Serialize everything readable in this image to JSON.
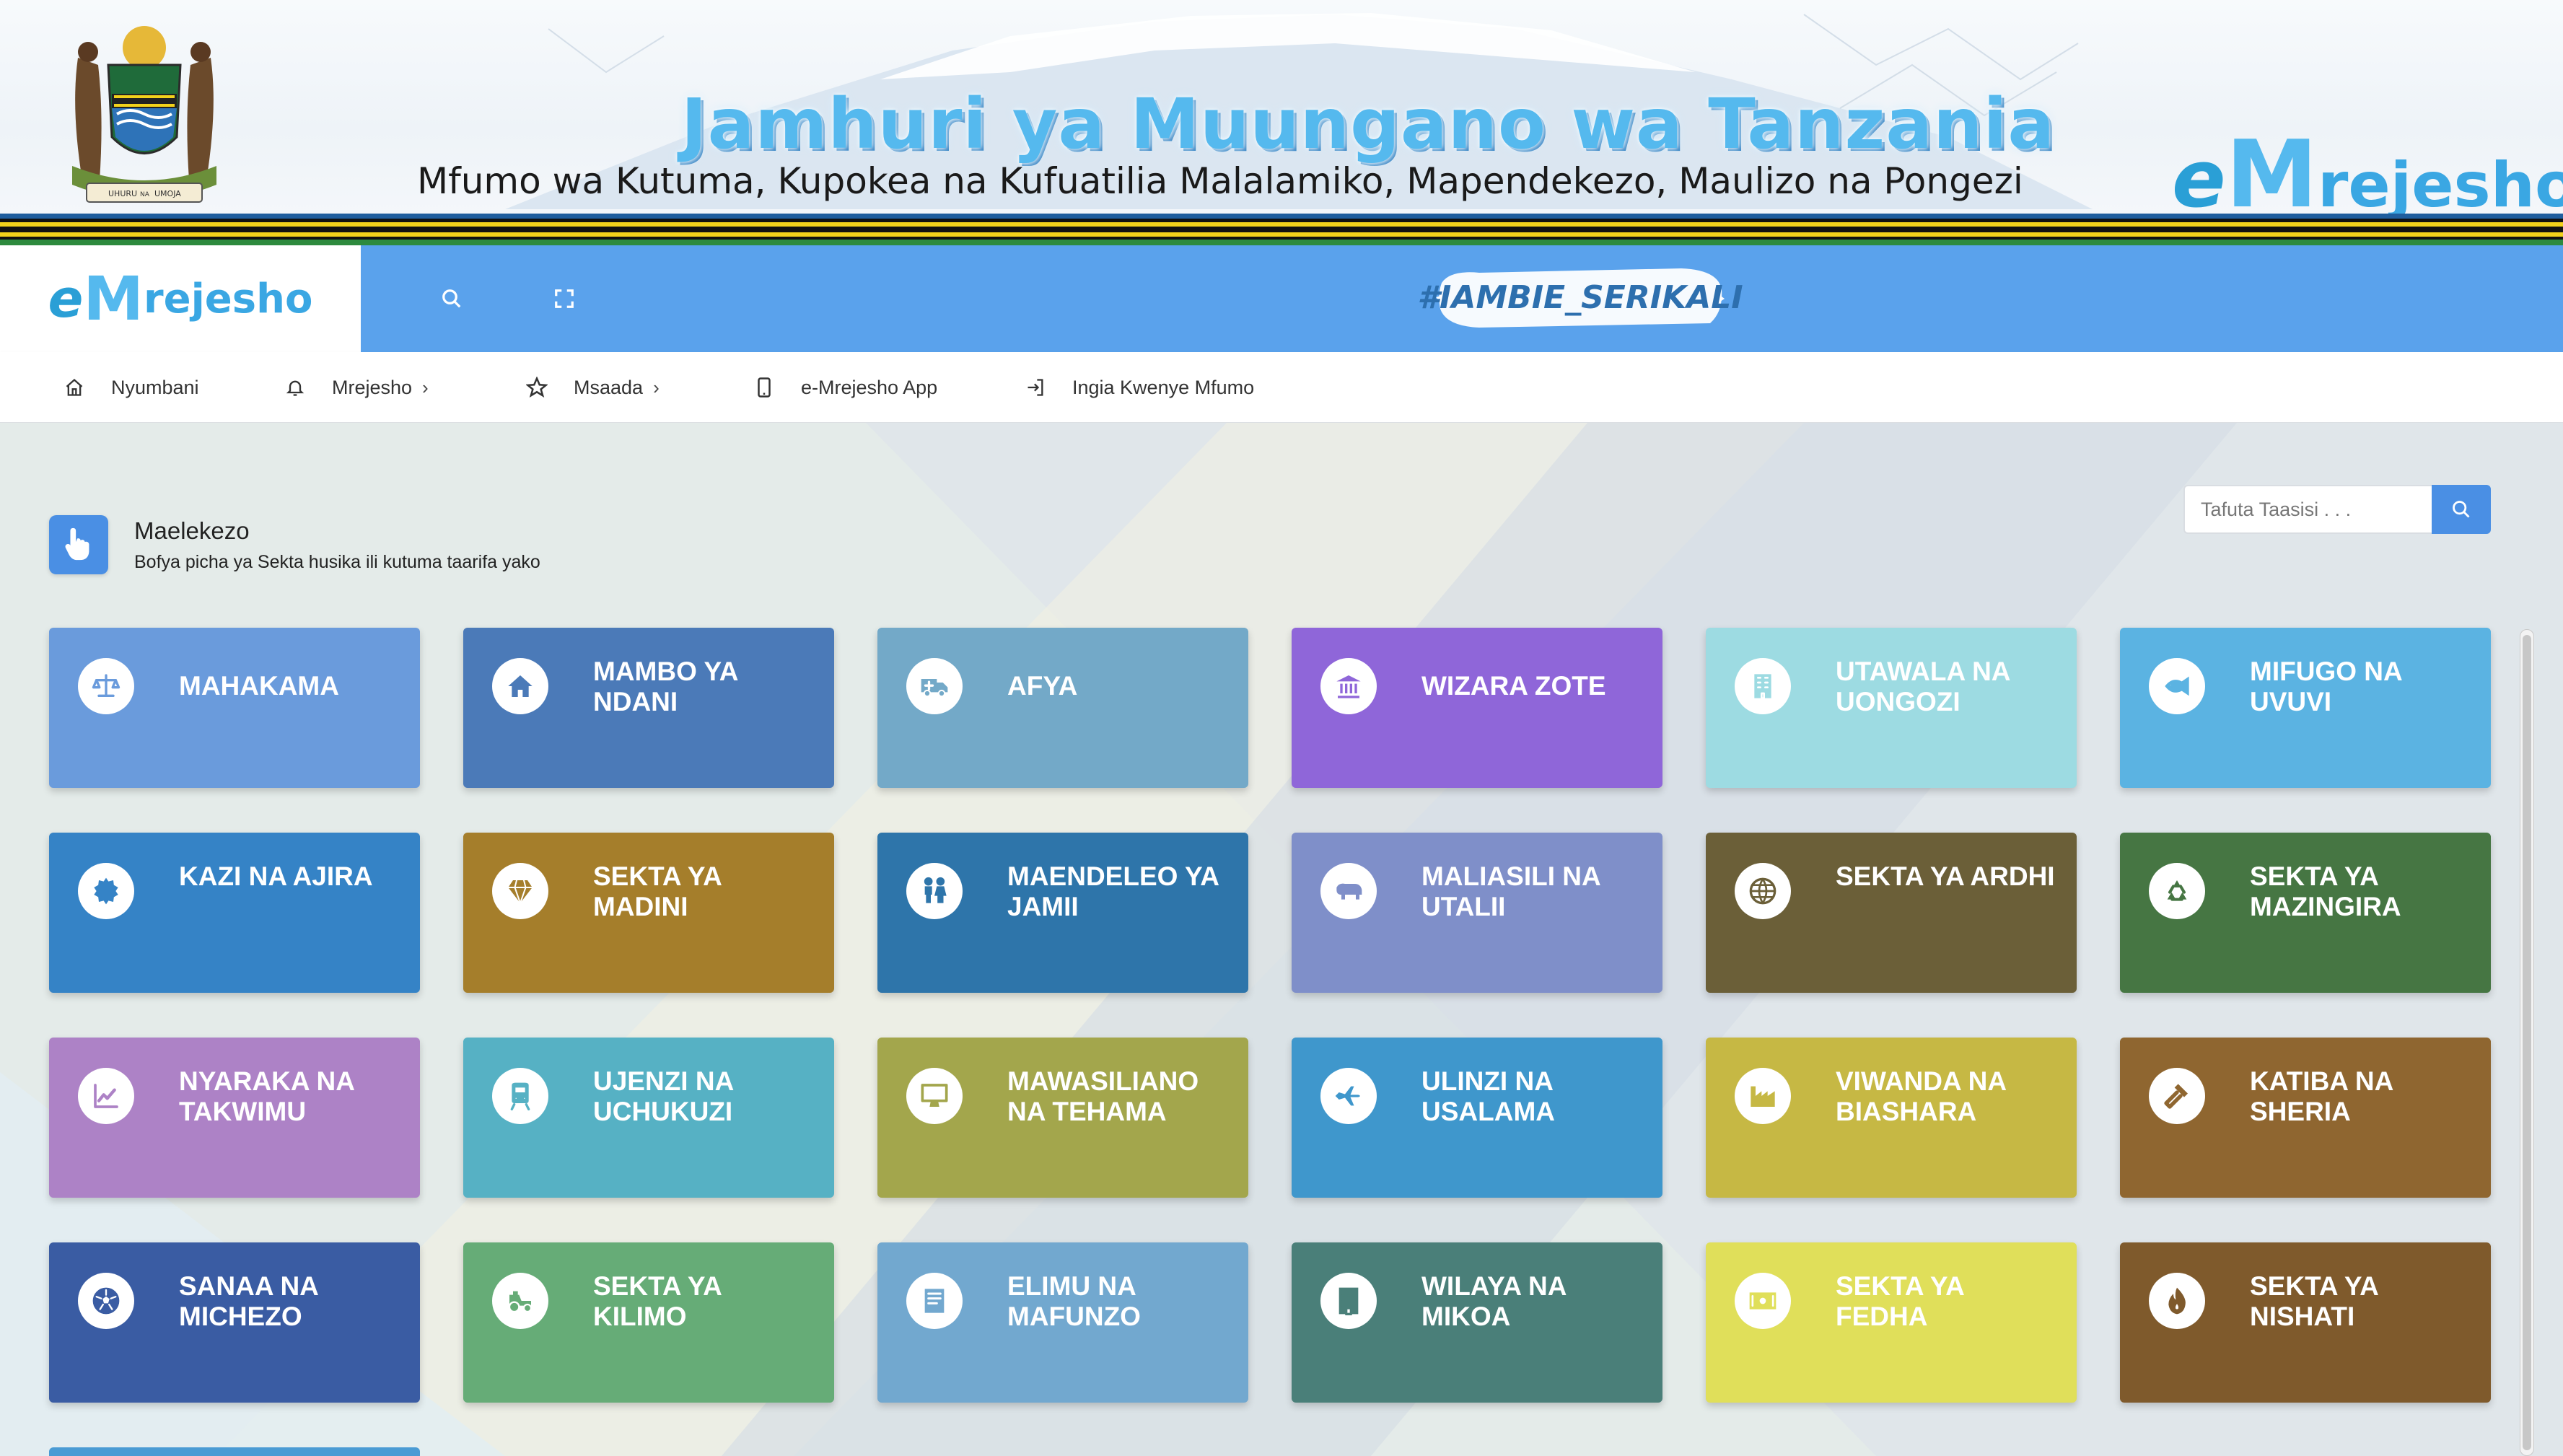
{
  "banner": {
    "title": "Jamhuri ya Muungano wa Tanzania",
    "subtitle": "Mfumo wa Kutuma, Kupokea na Kufuatilia Malalamiko, Mapendekezo, Maulizo na Pongezi",
    "logo": {
      "e": "e",
      "m": "M",
      "rest": "rejesho"
    },
    "coat_motto": {
      "left": "UHURU",
      "right": "UMOJA",
      "center": "NA"
    }
  },
  "topbar": {
    "logo": {
      "e": "e",
      "m": "M",
      "rest": "rejesho"
    },
    "icons": [
      "search-icon",
      "fullscreen-icon"
    ],
    "hashtag": "#IAMBIE_SERIKALI"
  },
  "menu": [
    {
      "label": "Nyumbani",
      "icon": "home-icon",
      "dropdown": false
    },
    {
      "label": "Mrejesho",
      "icon": "bell-icon",
      "dropdown": true
    },
    {
      "label": "Msaada",
      "icon": "star-icon",
      "dropdown": true
    },
    {
      "label": "e-Mrejesho App",
      "icon": "mobile-icon",
      "dropdown": false
    },
    {
      "label": "Ingia Kwenye Mfumo",
      "icon": "sign-in-icon",
      "dropdown": false
    }
  ],
  "guide": {
    "title": "Maelekezo",
    "subtitle": "Bofya picha ya Sekta husika ili kutuma taarifa yako",
    "icon": "pointer-hand-icon"
  },
  "search": {
    "placeholder": "Tafuta Taasisi . . ."
  },
  "sectors": [
    {
      "label": "MAHAKAMA",
      "icon": "scales-icon",
      "color": "#6a9bdc"
    },
    {
      "label": "MAMBO YA NDANI",
      "icon": "home-icon",
      "color": "#4b7ab8"
    },
    {
      "label": "AFYA",
      "icon": "ambulance-icon",
      "color": "#73a9c8"
    },
    {
      "label": "WIZARA ZOTE",
      "icon": "institution-icon",
      "color": "#8f66d9"
    },
    {
      "label": "UTAWALA NA UONGOZI",
      "icon": "building-icon",
      "color": "#9ddbe2"
    },
    {
      "label": "MIFUGO NA UVUVI",
      "icon": "fish-icon",
      "color": "#5bb3e2"
    },
    {
      "label": "KAZI NA AJIRA",
      "icon": "gear-icon",
      "color": "#3583c6"
    },
    {
      "label": "SEKTA YA MADINI",
      "icon": "diamond-icon",
      "color": "#a57e2b"
    },
    {
      "label": "MAENDELEO YA JAMII",
      "icon": "people-icon",
      "color": "#2e75aa"
    },
    {
      "label": "MALIASILI NA UTALII",
      "icon": "hippo-icon",
      "color": "#7f8fc9"
    },
    {
      "label": "SEKTA YA ARDHI",
      "icon": "globe-icon",
      "color": "#6b5f38"
    },
    {
      "label": "SEKTA YA MAZINGIRA",
      "icon": "recycle-icon",
      "color": "#467643"
    },
    {
      "label": "NYARAKA NA TAKWIMU",
      "icon": "chart-line-icon",
      "color": "#ad82c6"
    },
    {
      "label": "UJENZI NA UCHUKUZI",
      "icon": "train-icon",
      "color": "#56b1c4"
    },
    {
      "label": "MAWASILIANO NA TEHAMA",
      "icon": "desktop-icon",
      "color": "#a3a64c"
    },
    {
      "label": "ULINZI NA USALAMA",
      "icon": "plane-icon",
      "color": "#3f97cc"
    },
    {
      "label": "VIWANDA NA BIASHARA",
      "icon": "industry-icon",
      "color": "#c6b844"
    },
    {
      "label": "KATIBA NA SHERIA",
      "icon": "gavel-icon",
      "color": "#8f6630"
    },
    {
      "label": "SANAA NA MICHEZO",
      "icon": "football-icon",
      "color": "#3a5ca3"
    },
    {
      "label": "SEKTA YA KILIMO",
      "icon": "tractor-icon",
      "color": "#66ac77"
    },
    {
      "label": "ELIMU NA MAFUNZO",
      "icon": "book-icon",
      "color": "#72a8cf"
    },
    {
      "label": "WILAYA NA MIKOA",
      "icon": "office-building-icon",
      "color": "#4a7f79"
    },
    {
      "label": "SEKTA YA FEDHA",
      "icon": "money-icon",
      "color": "#e0df5a"
    },
    {
      "label": "SEKTA YA NISHATI",
      "icon": "fire-icon",
      "color": "#7f5a2c"
    }
  ],
  "partial_card": {
    "color": "#4a9bd4"
  }
}
